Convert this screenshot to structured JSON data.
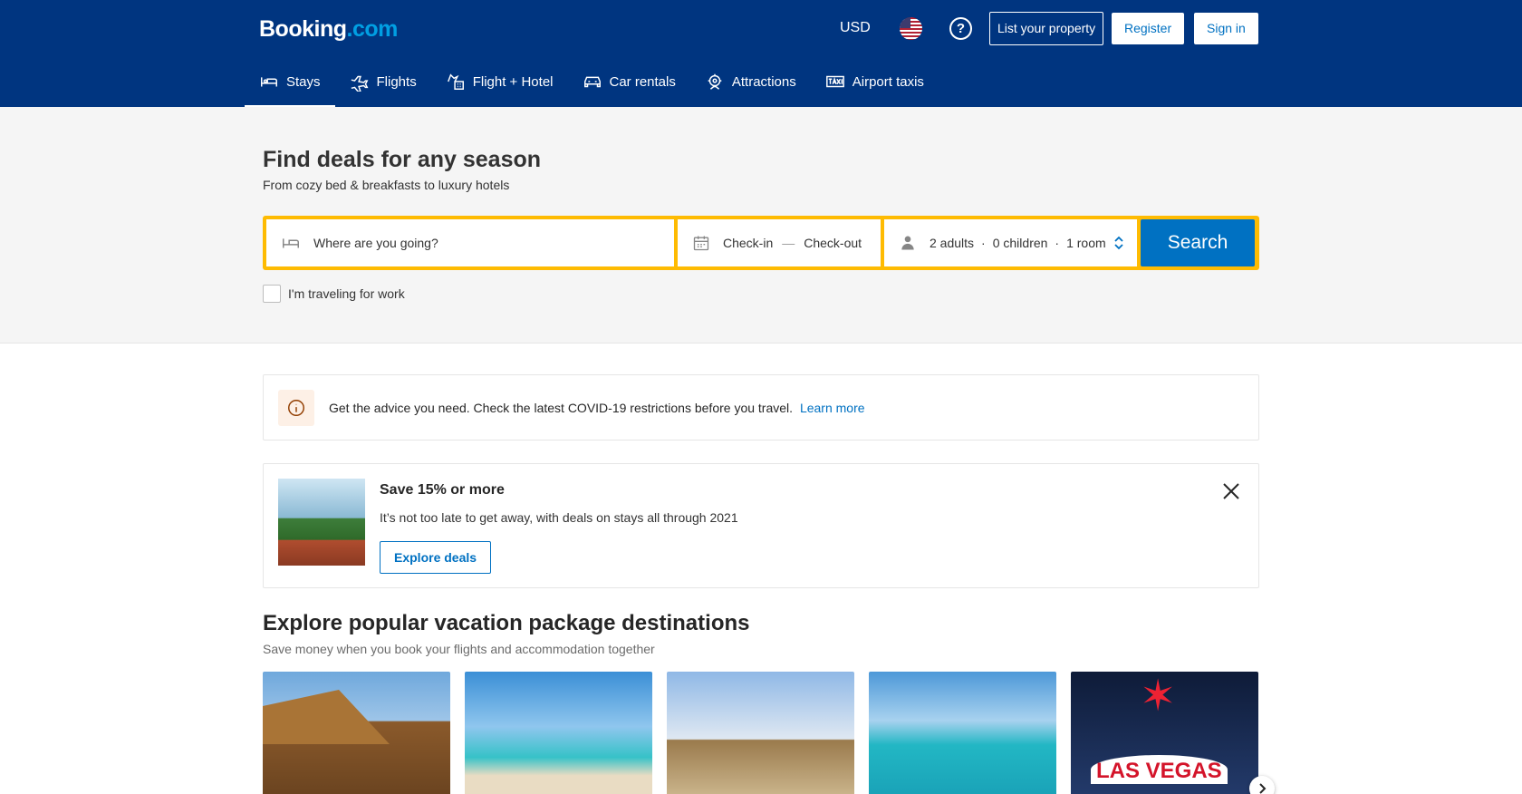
{
  "header": {
    "logo_main": "Booking",
    "logo_dot": ".com",
    "currency": "USD",
    "help": "?",
    "list_property": "List your property",
    "register": "Register",
    "sign_in": "Sign in"
  },
  "nav": [
    {
      "label": "Stays",
      "icon": "bed-icon",
      "active": true
    },
    {
      "label": "Flights",
      "icon": "plane-icon"
    },
    {
      "label": "Flight + Hotel",
      "icon": "flight-hotel-icon"
    },
    {
      "label": "Car rentals",
      "icon": "car-icon"
    },
    {
      "label": "Attractions",
      "icon": "attractions-icon"
    },
    {
      "label": "Airport taxis",
      "icon": "taxi-icon"
    }
  ],
  "hero": {
    "title": "Find deals for any season",
    "subtitle": "From cozy bed & breakfasts to luxury hotels"
  },
  "search": {
    "destination_placeholder": "Where are you going?",
    "checkin": "Check-in",
    "date_sep": "—",
    "checkout": "Check-out",
    "adults": "2 adults",
    "children": "0 children",
    "rooms": "1 room",
    "dot": "·",
    "button": "Search",
    "work_label": "I'm traveling for work"
  },
  "covid": {
    "text": "Get the advice you need. Check the latest COVID-19 restrictions before you travel.",
    "link": "Learn more"
  },
  "promo": {
    "title": "Save 15% or more",
    "subtitle": "It’s not too late to get away, with deals on stays all through 2021",
    "button": "Explore deals"
  },
  "destinations": {
    "title": "Explore popular vacation package destinations",
    "subtitle": "Save money when you book your flights and accommodation together",
    "las_vegas_sign": "LAS VEGAS"
  },
  "colors": {
    "brand_blue": "#003580",
    "action_blue": "#0071c2",
    "search_yellow": "#febb02"
  }
}
